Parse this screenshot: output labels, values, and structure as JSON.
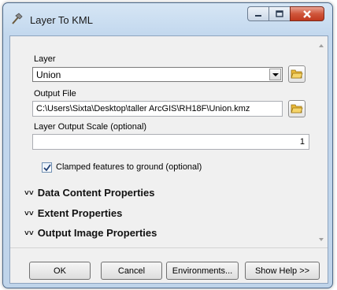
{
  "window": {
    "title": "Layer To KML"
  },
  "form": {
    "layer_label": "Layer",
    "layer_value": "Union",
    "output_file_label": "Output File",
    "output_file_value": "C:\\Users\\Sixta\\Desktop\\taller ArcGIS\\RH18F\\Union.kmz",
    "scale_label": "Layer Output Scale (optional)",
    "scale_value": "1",
    "clamped_label": "Clamped features to ground (optional)",
    "clamped_checked": true
  },
  "sections": [
    {
      "label": "Data Content Properties"
    },
    {
      "label": "Extent Properties"
    },
    {
      "label": "Output Image Properties"
    }
  ],
  "buttons": {
    "ok": "OK",
    "cancel": "Cancel",
    "environments": "Environments...",
    "show_help": "Show Help >>"
  },
  "icons": {
    "app": "hammer-icon",
    "folder": "open-folder-icon",
    "chevron": "double-chevron-down-icon"
  },
  "colors": {
    "frame": "#c3d8ee",
    "close": "#c9452b",
    "folder": "#e8b838"
  }
}
